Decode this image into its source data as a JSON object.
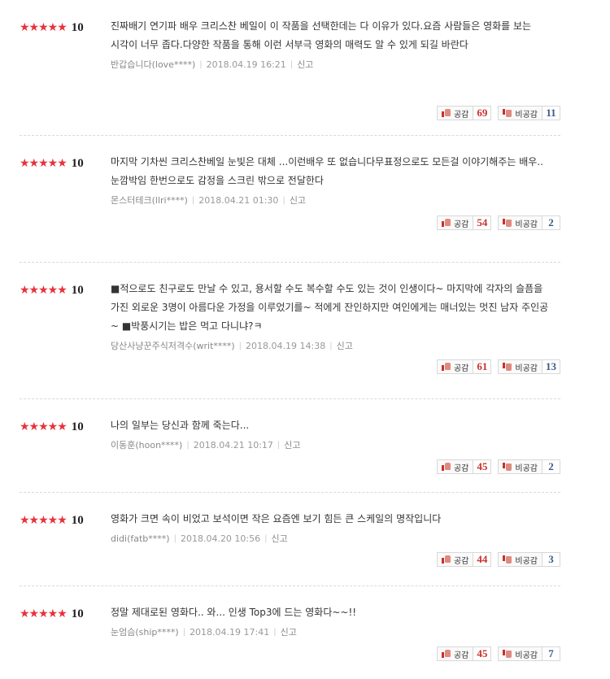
{
  "labels": {
    "like": "공감",
    "dislike": "비공감",
    "report": "신고"
  },
  "accent_color": "#e8323c",
  "reviews": [
    {
      "stars": "★★★★★",
      "score": "10",
      "text": "진짜배기 연기파 배우 크리스찬 베일이 이 작품을 선택한데는 다 이유가 있다.요즘 사람들은 영화를 보는 시각이 너무 좁다.다양한 작품을 통해 이런 서부극 영화의 매력도 알 수 있게 되길 바란다",
      "user": "반갑습니다(love****)",
      "date": "2018.04.19 16:21",
      "likes": "69",
      "dislikes": "11"
    },
    {
      "stars": "★★★★★",
      "score": "10",
      "text": "마지막 기차씬 크리스찬베일 눈빛은 대체 ...이런배우 또 없습니다무표정으로도 모든걸 이야기해주는 배우..눈깜박임 한번으로도 감정을 스크린 밖으로 전달한다",
      "user": "몬스터테크(llri****)",
      "date": "2018.04.21 01:30",
      "likes": "54",
      "dislikes": "2"
    },
    {
      "stars": "★★★★★",
      "score": "10",
      "text": "■적으로도 친구로도 만날 수 있고, 용서할 수도 복수할 수도 있는 것이 인생이다~ 마지막에 각자의 슬픔을 가진 외로운 3명이 아름다운 가정을 이루었기를~ 적에게 잔인하지만 여인에게는 매너있는 멋진 남자 주인공~ ■박풍시기는 밥은 먹고 다니냐?ㅋ",
      "user": "당산사냥꾼주식저격수(writ****)",
      "date": "2018.04.19 14:38",
      "likes": "61",
      "dislikes": "13"
    },
    {
      "stars": "★★★★★",
      "score": "10",
      "text": "나의 일부는 당신과 함께 죽는다...",
      "user": "이동훈(hoon****)",
      "date": "2018.04.21 10:17",
      "likes": "45",
      "dislikes": "2"
    },
    {
      "stars": "★★★★★",
      "score": "10",
      "text": "영화가 크면 속이 비었고 보석이면 작은 요즘엔 보기 힘든 큰 스케일의 명작입니다",
      "user": "didi(fatb****)",
      "date": "2018.04.20 10:56",
      "likes": "44",
      "dislikes": "3"
    },
    {
      "stars": "★★★★★",
      "score": "10",
      "text": "정말 제대로된 영화다.. 와... 인생 Top3에 드는 영화다~~!!",
      "user": "눈엄슴(ship****)",
      "date": "2018.04.19 17:41",
      "likes": "45",
      "dislikes": "7"
    }
  ]
}
